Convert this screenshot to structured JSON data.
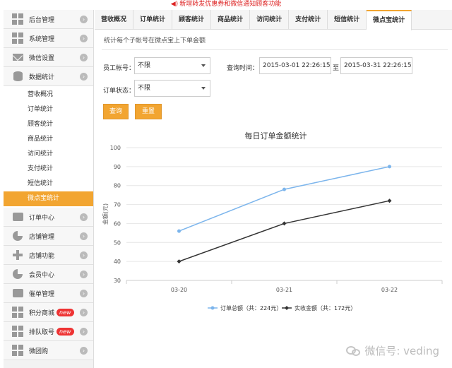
{
  "announcement": "新增转发优惠券和微信通知顾客功能",
  "sidebar": {
    "items": [
      {
        "label": "后台管理",
        "icon": "grid-icon"
      },
      {
        "label": "系统管理",
        "icon": "grid-icon"
      },
      {
        "label": "微信设置",
        "icon": "mail-icon"
      },
      {
        "label": "数据统计",
        "icon": "database-icon"
      }
    ],
    "sub_items": [
      "营收概况",
      "订单统计",
      "顾客统计",
      "商品统计",
      "访问统计",
      "支付统计",
      "短信统计",
      "微点宝统计"
    ],
    "bottom_items": [
      {
        "label": "订单中心",
        "icon": "printer-icon",
        "badge": ""
      },
      {
        "label": "店铺管理",
        "icon": "pie-icon",
        "badge": ""
      },
      {
        "label": "店铺功能",
        "icon": "plus-icon",
        "badge": ""
      },
      {
        "label": "会员中心",
        "icon": "pie-icon",
        "badge": ""
      },
      {
        "label": "催单管理",
        "icon": "printer-icon",
        "badge": ""
      },
      {
        "label": "积分商城",
        "icon": "grid-icon",
        "badge": "new"
      },
      {
        "label": "排队取号",
        "icon": "grid-icon",
        "badge": "new"
      },
      {
        "label": "微团购",
        "icon": "grid-icon",
        "badge": ""
      }
    ]
  },
  "tabs": [
    "营收概况",
    "订单统计",
    "顾客统计",
    "商品统计",
    "访问统计",
    "支付统计",
    "短信统计",
    "微点宝统计"
  ],
  "active_tab": "微点宝统计",
  "description": "统计每个子帐号在微点宝上下单金额",
  "form": {
    "staff_label": "员工帐号：",
    "staff_value": "不限",
    "time_label": "查询时间：",
    "date_from": "2015-03-01 22:26:15",
    "date_sep": "至",
    "date_to": "2015-03-31 22:26:15",
    "status_label": "订单状态：",
    "status_value": "不限",
    "query_button": "查询",
    "reset_button": "重置"
  },
  "chart_data": {
    "type": "line",
    "title": "每日订单金额统计",
    "ylabel": "金额(元)",
    "categories": [
      "03-20",
      "03-21",
      "03-22"
    ],
    "ylim": [
      30,
      100
    ],
    "yticks": [
      30,
      40,
      50,
      60,
      70,
      80,
      90,
      100
    ],
    "series": [
      {
        "name": "订单总额（共：224元）",
        "values": [
          56,
          78,
          90
        ],
        "color": "#7cb5ec"
      },
      {
        "name": "实收金额（共：172元）",
        "values": [
          40,
          60,
          72
        ],
        "color": "#333333"
      }
    ],
    "grid": true,
    "legend": "bottom"
  },
  "watermark": "微信号: veding",
  "colors": {
    "accent": "#f2a531",
    "badge": "#e33333"
  }
}
